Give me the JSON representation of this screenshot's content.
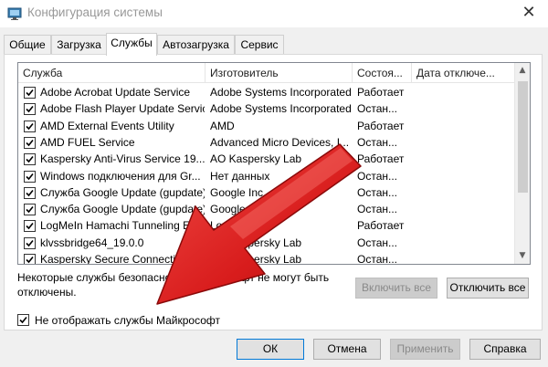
{
  "window": {
    "title": "Конфигурация системы",
    "close_glyph": "✕"
  },
  "tabs": [
    {
      "label": "Общие",
      "active": false
    },
    {
      "label": "Загрузка",
      "active": false
    },
    {
      "label": "Службы",
      "active": true
    },
    {
      "label": "Автозагрузка",
      "active": false
    },
    {
      "label": "Сервис",
      "active": false
    }
  ],
  "table": {
    "columns": [
      "Служба",
      "Изготовитель",
      "Состоя...",
      "Дата отключе..."
    ],
    "rows": [
      {
        "checked": true,
        "service": "Adobe Acrobat Update Service",
        "maker": "Adobe Systems Incorporated",
        "status": "Работает"
      },
      {
        "checked": true,
        "service": "Adobe Flash Player Update Service",
        "maker": "Adobe Systems Incorporated",
        "status": "Остан..."
      },
      {
        "checked": true,
        "service": "AMD External Events Utility",
        "maker": "AMD",
        "status": "Работает"
      },
      {
        "checked": true,
        "service": "AMD FUEL Service",
        "maker": "Advanced Micro Devices, I...",
        "status": "Остан..."
      },
      {
        "checked": true,
        "service": "Kaspersky Anti-Virus Service 19....",
        "maker": "AO Kaspersky Lab",
        "status": "Работает"
      },
      {
        "checked": true,
        "service": "Windows подключения для Gr...",
        "maker": "Нет данных",
        "status": "Остан..."
      },
      {
        "checked": true,
        "service": "Служба Google Update (gupdate)",
        "maker": "Google Inc.",
        "status": "Остан..."
      },
      {
        "checked": true,
        "service": "Служба Google Update (gupdate)",
        "maker": "Google Inc.",
        "status": "Остан..."
      },
      {
        "checked": true,
        "service": "LogMeIn Hamachi Tunneling Engine",
        "maker": "LogMeIn Inc.",
        "status": "Работает"
      },
      {
        "checked": true,
        "service": "klvssbridge64_19.0.0",
        "maker": "AO Kaspersky Lab",
        "status": "Остан..."
      },
      {
        "checked": true,
        "service": "Kaspersky Secure Connection...",
        "maker": "AO Kaspersky Lab",
        "status": "Остан..."
      }
    ]
  },
  "notice": "Некоторые службы безопасности Майкрософт не могут быть отключены.",
  "buttons": {
    "enable_all": "Включить все",
    "disable_all": "Отключить все",
    "ok": "ОК",
    "cancel": "Отмена",
    "apply": "Применить",
    "help": "Справка"
  },
  "hide_ms": {
    "label": "Не отображать службы Майкрософт",
    "checked": true
  },
  "colors": {
    "annotation_arrow": "#e01d1d"
  }
}
